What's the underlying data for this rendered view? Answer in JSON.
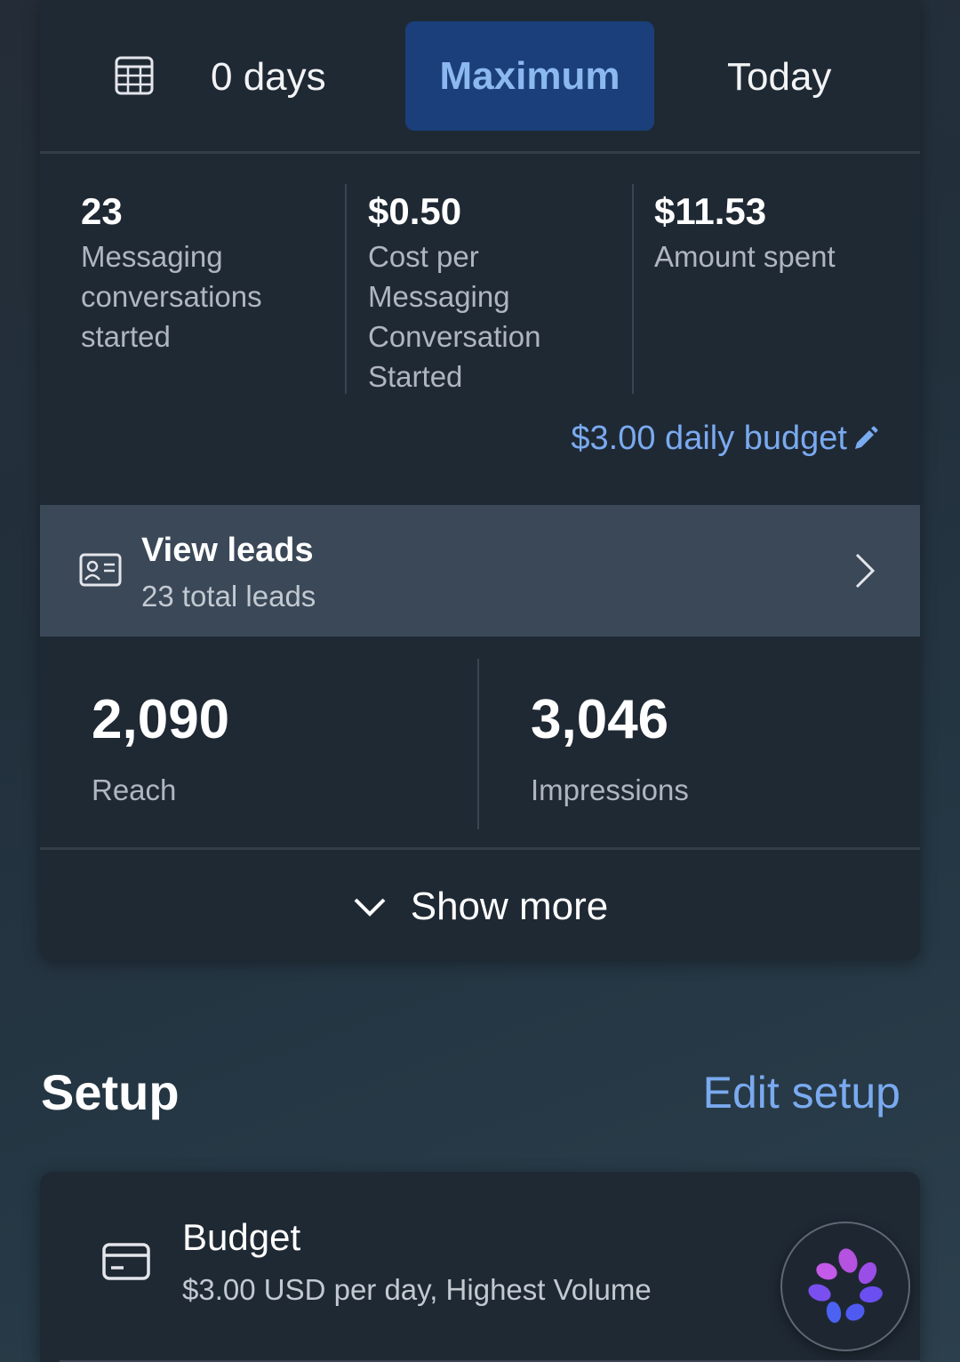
{
  "date_range": {
    "calendar_icon": "calendar-table-icon",
    "days_label": "0 days",
    "tabs": [
      {
        "label": "Maximum",
        "selected": true
      },
      {
        "label": "Today",
        "selected": false
      }
    ]
  },
  "metrics": [
    {
      "value": "23",
      "label": "Messaging conversations started"
    },
    {
      "value": "$0.50",
      "label": "Cost per Messaging Conversation Started"
    },
    {
      "value": "$11.53",
      "label": "Amount spent"
    }
  ],
  "budget_link": {
    "label": "$3.00 daily budget",
    "icon": "pencil-icon"
  },
  "leads": {
    "title": "View leads",
    "subtitle": "23 total leads",
    "icon": "contact-card-icon"
  },
  "stats": [
    {
      "value": "2,090",
      "label": "Reach"
    },
    {
      "value": "3,046",
      "label": "Impressions"
    }
  ],
  "show_more": {
    "label": "Show more"
  },
  "setup": {
    "title": "Setup",
    "edit_label": "Edit setup",
    "budget": {
      "title": "Budget",
      "description": "$3.00 USD per day, Highest Volume",
      "icon": "credit-card-icon"
    }
  },
  "colors": {
    "accent": "#7aaaf0",
    "selected_tab_bg": "#1b3f7a",
    "card_bg": "#1f2934",
    "leads_bg": "#3a4858"
  }
}
